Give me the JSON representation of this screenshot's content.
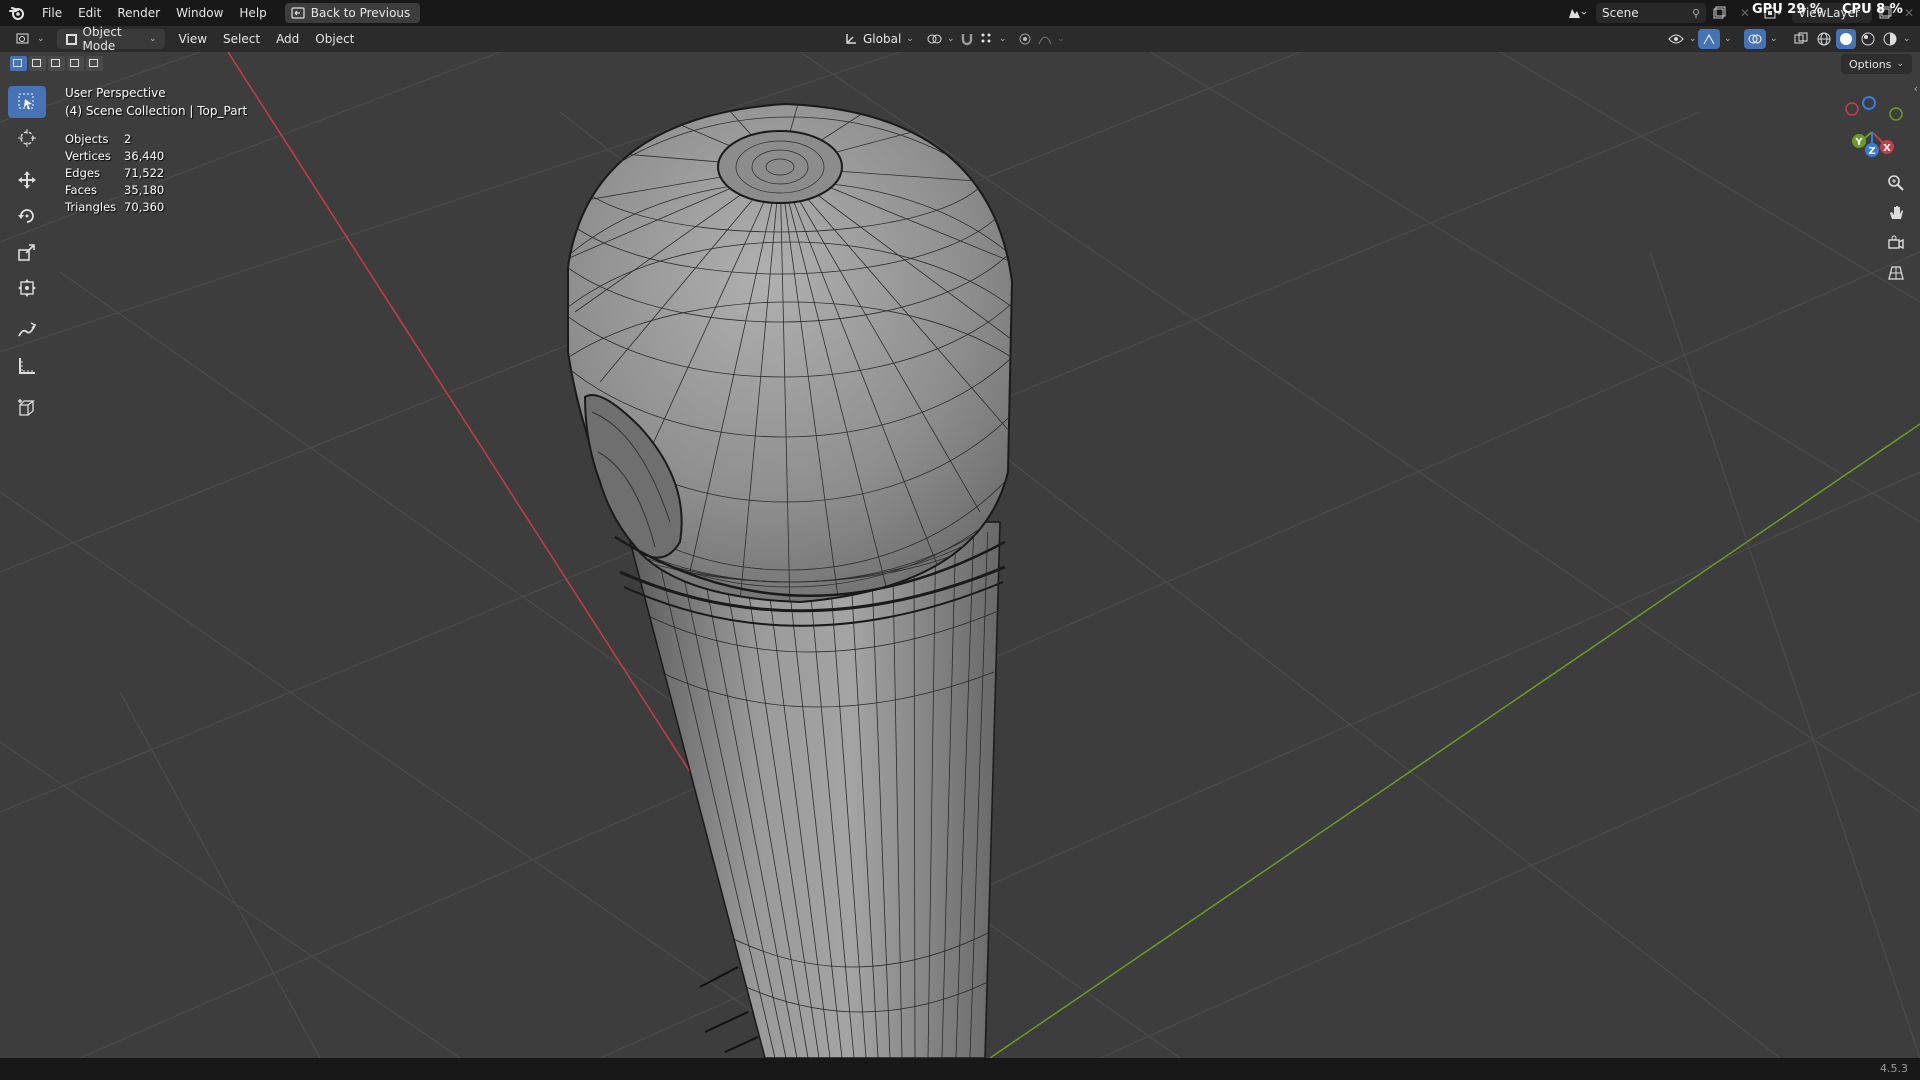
{
  "topbar": {
    "menu": [
      "File",
      "Edit",
      "Render",
      "Window",
      "Help"
    ],
    "back_button": "Back to Previous",
    "scene_name": "Scene",
    "view_layer": "ViewLayer",
    "gpu_label": "GPU",
    "gpu_value": "29 %",
    "cpu_label": "CPU",
    "cpu_value": "8 %"
  },
  "header": {
    "mode": "Object Mode",
    "menus": [
      "View",
      "Select",
      "Add",
      "Object"
    ],
    "transform_orientation": "Global",
    "options": "Options"
  },
  "viewport": {
    "perspective": "User Perspective",
    "collection": "(4) Scene Collection | Top_Part",
    "stats": [
      {
        "label": "Objects",
        "value": "2"
      },
      {
        "label": "Vertices",
        "value": "36,440"
      },
      {
        "label": "Edges",
        "value": "71,522"
      },
      {
        "label": "Faces",
        "value": "35,180"
      },
      {
        "label": "Triangles",
        "value": "70,360"
      }
    ],
    "gizmo": {
      "x": "X",
      "y": "Y",
      "z": "Z"
    }
  },
  "toolbar": {
    "tools": [
      "select-box-icon",
      "cursor-icon",
      "move-icon",
      "rotate-icon",
      "scale-icon",
      "transform-icon",
      "annotate-icon",
      "measure-icon",
      "add-cube-icon"
    ]
  },
  "statusbar": {
    "version": "4.5.3"
  },
  "colors": {
    "accent": "#4772b3",
    "viewport_bg": "#3d3d3d",
    "x_axis": "#c43e47",
    "y_axis": "#6e9a27"
  }
}
